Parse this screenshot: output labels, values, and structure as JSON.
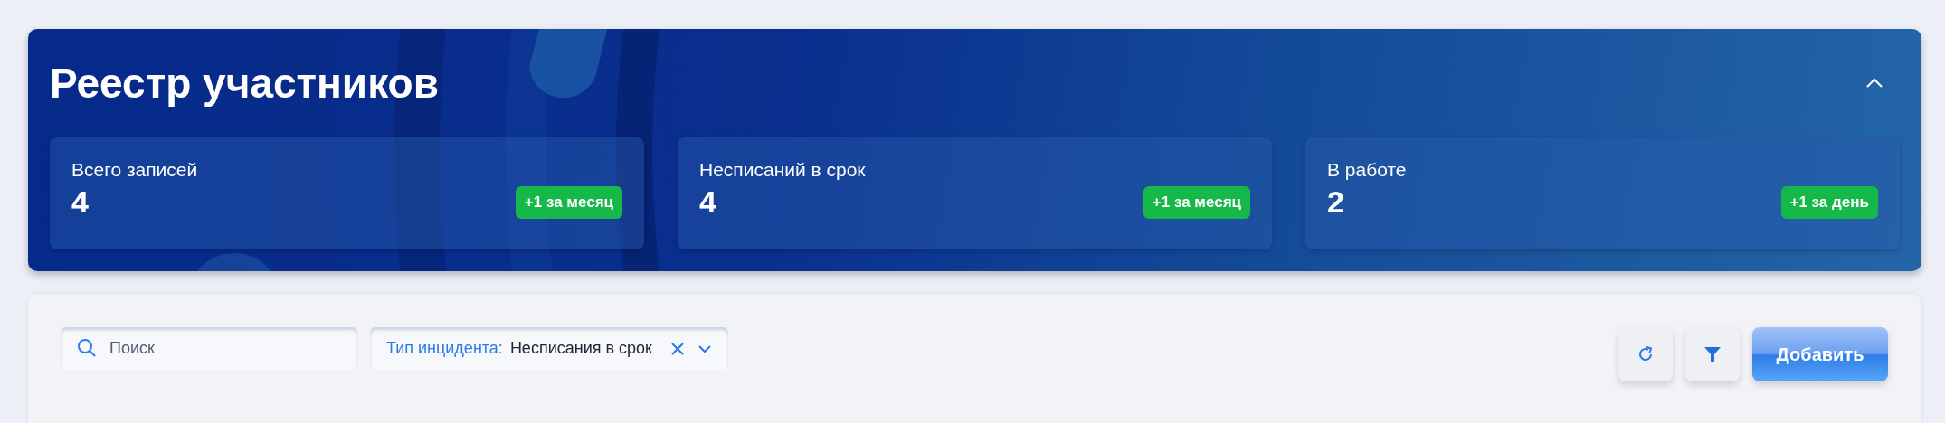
{
  "header": {
    "title": "Реестр участников",
    "expanded": true
  },
  "stats": [
    {
      "label": "Всего записей",
      "value": "4",
      "badge": "+1 за месяц"
    },
    {
      "label": "Несписаний в срок",
      "value": "4",
      "badge": "+1 за месяц"
    },
    {
      "label": "В работе",
      "value": "2",
      "badge": "+1 за день"
    }
  ],
  "toolbar": {
    "search": {
      "placeholder": "Поиск"
    },
    "filter_chip": {
      "label": "Тип инцидента:",
      "value": "Несписания в срок"
    },
    "add_button": "Добавить"
  }
}
